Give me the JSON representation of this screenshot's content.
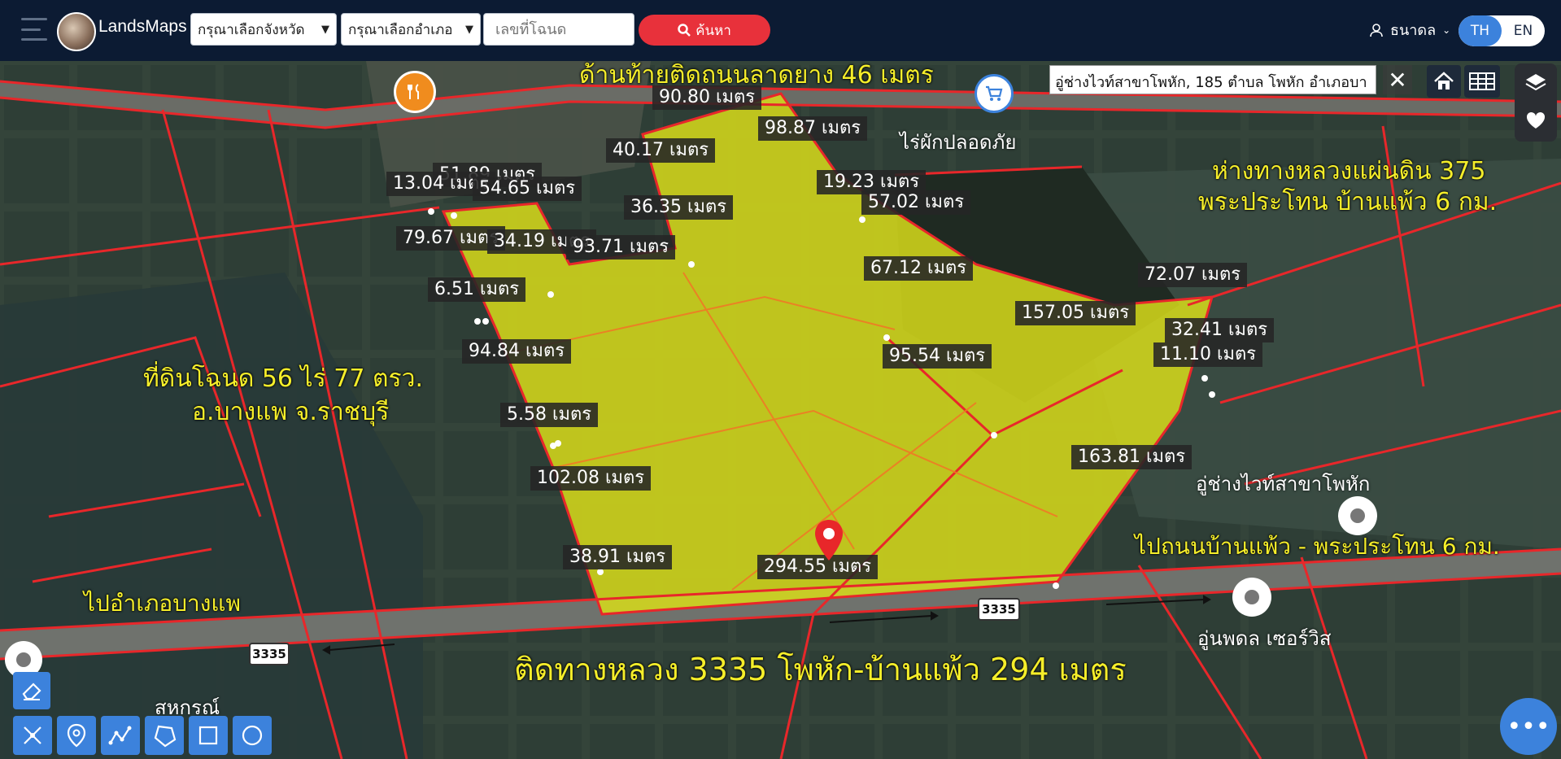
{
  "app": {
    "brand": "LandsMaps"
  },
  "header": {
    "province_select": "กรุณาเลือกจังหวัด",
    "district_select": "กรุณาเลือกอำเภอ",
    "deed_placeholder": "เลขที่โฉนด",
    "search_label": "ค้นหา",
    "user_name": "ธนาดล",
    "lang_th": "TH",
    "lang_en": "EN"
  },
  "address_bar": {
    "text": "อู่ช่างไวท์สาขาโพหัก, 185 ตำบล โพหัก อำเภอบา",
    "close": "✕"
  },
  "measurements": [
    "ด้านท้ายติดถนนลาดยาง 46 เมตร",
    "90.80 เมตร",
    "98.87 เมตร",
    "40.17 เมตร",
    "51.89 เมตร",
    "13.04 เมตร",
    "54.65 เมตร",
    "19.23 เมตร",
    "36.35 เมตร",
    "57.02 เมตร",
    "79.67 เมตร",
    "34.19 เมตร",
    "93.71 เมตร",
    "67.12 เมตร",
    "72.07 เมตร",
    "6.51 เมตร",
    "157.05 เมตร",
    "32.41 เมตร",
    "94.84 เมตร",
    "95.54 เมตร",
    "11.10 เมตร",
    "5.58 เมตร",
    "163.81 เมตร",
    "102.08 เมตร",
    "38.91 เมตร",
    "294.55 เมตร"
  ],
  "annotations": {
    "top_road": "ด้านท้ายติดถนนลาดยาง 46 เมตร",
    "distance_line1": "ห่างทางหลวงแผ่นดิน 375",
    "distance_line2": "พระประโทน บ้านแพ้ว 6 กม.",
    "deed_line1": "ที่ดินโฉนด 56 ไร่ 77 ตรว.",
    "deed_line2": "อ.บางแพ จ.ราชบุรี",
    "to_banphaeo": "ไปถนนบ้านแพ้ว - พระประโทน 6 กม.",
    "to_bangphae": "ไปอำเภอบางแพ",
    "frontage": "ติดทางหลวง 3335 โพหัก-บ้านแพ้ว 294 เมตร"
  },
  "places": {
    "shop_top": "ไร่ผักปลอดภัย",
    "garage": "อู่ช่างไวท์สาขาโพหัก",
    "union": "อู่นพดล เซอร์วิส",
    "cooperative": "สหกรณ์",
    "road_code": "3335"
  },
  "map_colors": {
    "parcel_fill": "#d8dc1a",
    "boundary": "#e8272a"
  },
  "icons": {
    "home": "home-icon",
    "grid": "grid-icon",
    "layers": "layers-icon",
    "favorite": "heart-icon",
    "menu": "more-icon"
  }
}
